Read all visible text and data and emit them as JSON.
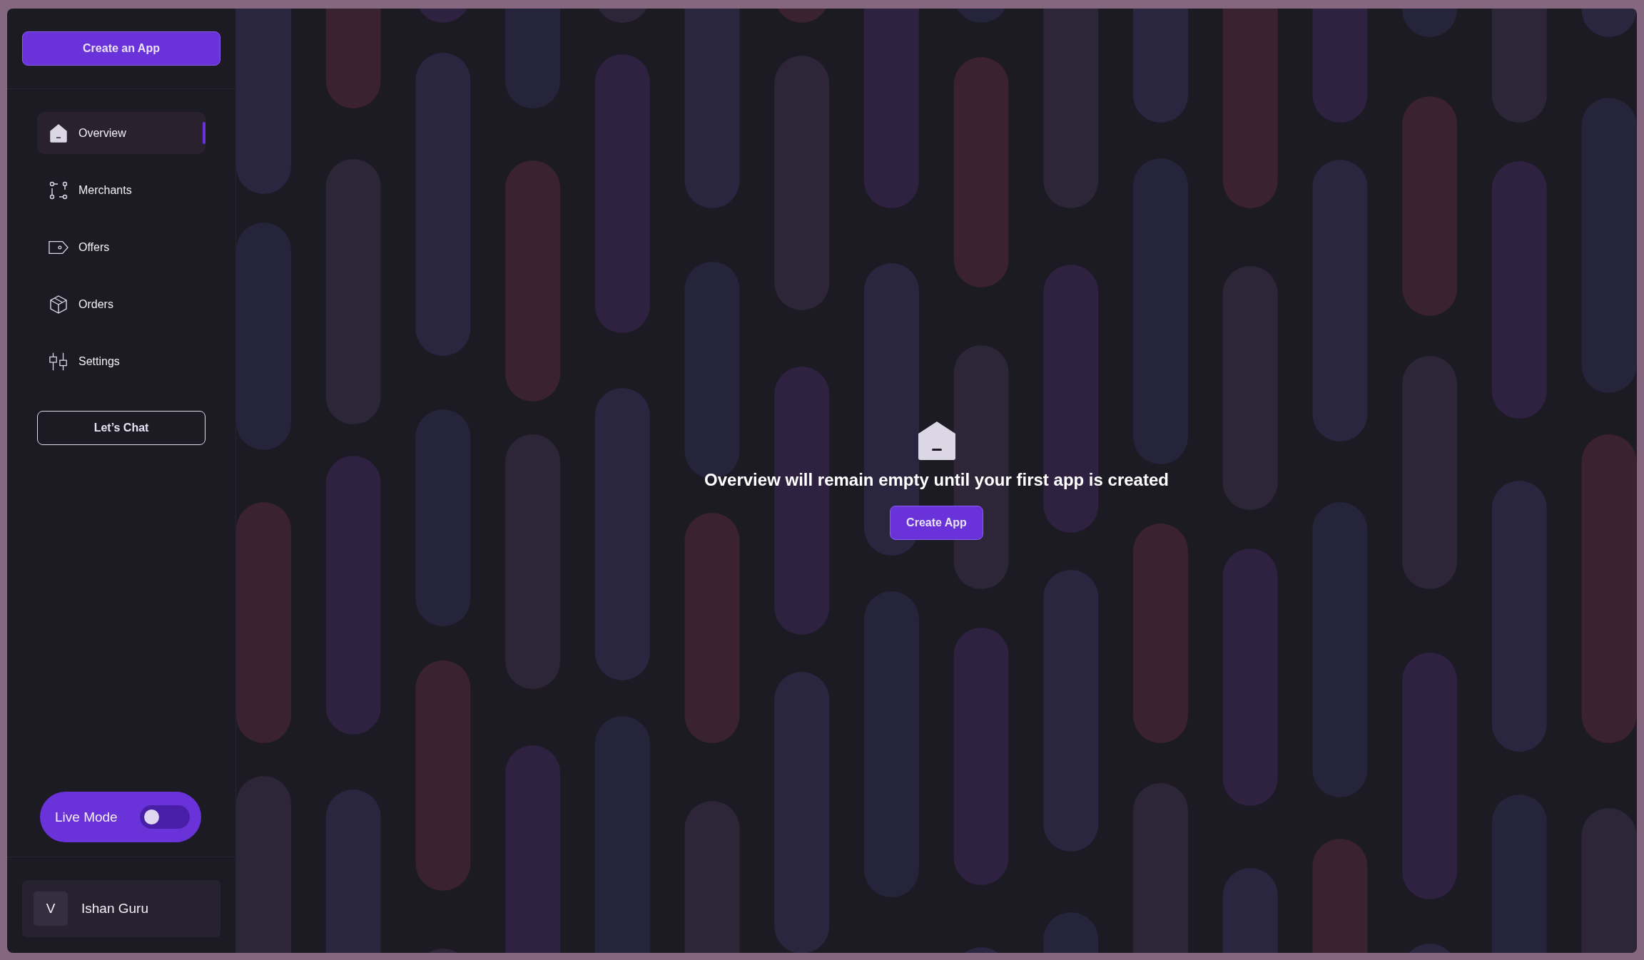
{
  "sidebar": {
    "create_button": "Create an App",
    "nav": [
      {
        "label": "Overview",
        "selected": true
      },
      {
        "label": "Merchants",
        "selected": false
      },
      {
        "label": "Offers",
        "selected": false
      },
      {
        "label": "Orders",
        "selected": false
      },
      {
        "label": "Settings",
        "selected": false
      }
    ],
    "chat_button": "Let’s Chat",
    "live_mode": {
      "label": "Live Mode",
      "on": false
    },
    "user": {
      "avatar": "V",
      "name": "Ishan Guru"
    }
  },
  "empty_state": {
    "message": "Overview will remain empty until your first app is created",
    "button": "Create App"
  }
}
